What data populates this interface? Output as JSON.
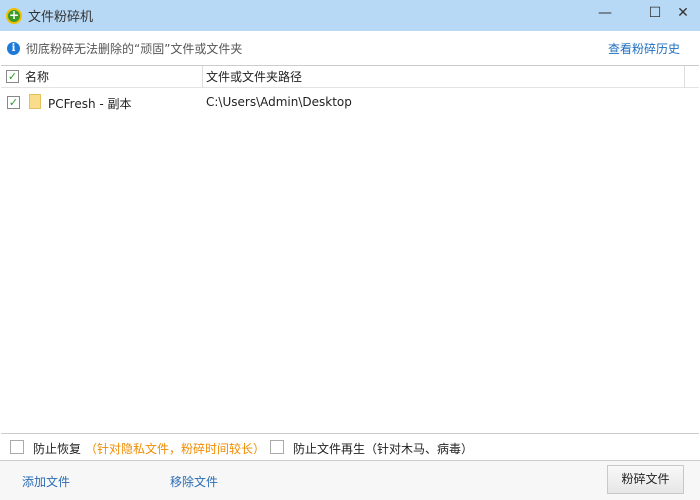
{
  "window": {
    "title": "文件粉碎机",
    "minimize": "—",
    "maximize": "☐",
    "close": "✕"
  },
  "info": {
    "text": "彻底粉碎无法删除的“顽固”文件或文件夹",
    "history_link": "查看粉碎历史"
  },
  "table": {
    "headers": [
      "名称",
      "文件或文件夹路径"
    ],
    "header_checked": true,
    "rows": [
      {
        "checked": true,
        "name": "PCFresh - 副本",
        "path": "C:\\Users\\Admin\\Desktop"
      }
    ]
  },
  "options": {
    "prevent_recovery": "防止恢复",
    "prevent_recovery_note": "（针对隐私文件，粉碎时间较长）",
    "prevent_regen": "防止文件再生（针对木马、病毒）"
  },
  "footer": {
    "add": "添加文件",
    "remove": "移除文件",
    "shred": "粉碎文件"
  },
  "colors": {
    "titlebar": "#b8d9f6",
    "link": "#2a6cb5",
    "note": "#f08c00"
  }
}
